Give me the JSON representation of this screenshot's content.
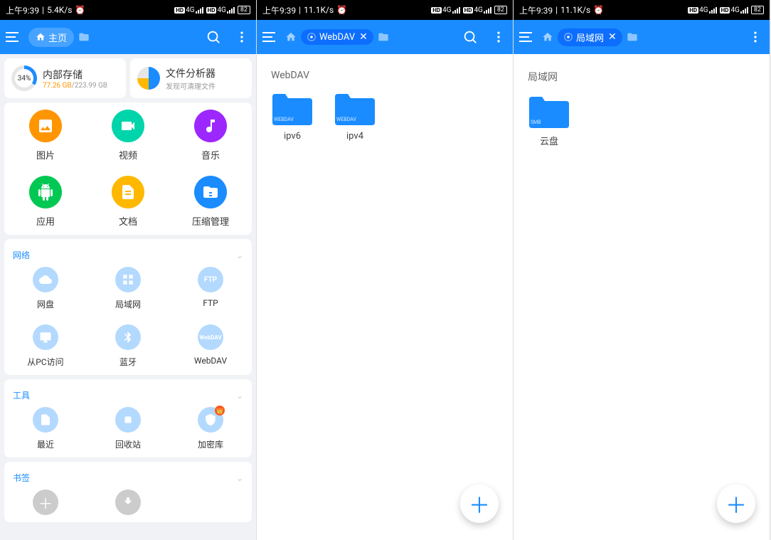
{
  "status": {
    "time": "上午9:39",
    "speed1": "5.4K/s",
    "speed2": "11.1K/s",
    "speed3": "11.1K/s",
    "net_label": "4G",
    "battery": "82"
  },
  "panel1": {
    "breadcrumb_label": "主页",
    "storage": {
      "title": "内部存储",
      "used": "77.26 GB",
      "total": "/223.99 GB",
      "percent": "34%"
    },
    "analyzer": {
      "title": "文件分析器",
      "sub": "发现可清理文件"
    },
    "categories": [
      {
        "label": "图片",
        "color": "#ff9500"
      },
      {
        "label": "视频",
        "color": "#00d4aa"
      },
      {
        "label": "音乐",
        "color": "#9c27ff"
      },
      {
        "label": "应用",
        "color": "#00c853"
      },
      {
        "label": "文档",
        "color": "#ffb800"
      },
      {
        "label": "压缩管理",
        "color": "#1a8cff"
      }
    ],
    "network": {
      "title": "网络",
      "items": [
        {
          "label": "网盘"
        },
        {
          "label": "局域网"
        },
        {
          "label": "FTP"
        },
        {
          "label": "从PC访问"
        },
        {
          "label": "蓝牙"
        },
        {
          "label": "WebDAV"
        }
      ]
    },
    "tools": {
      "title": "工具",
      "items": [
        {
          "label": "最近"
        },
        {
          "label": "回收站"
        },
        {
          "label": "加密库",
          "badge": true
        }
      ]
    },
    "bookmarks": {
      "title": "书签"
    }
  },
  "panel2": {
    "breadcrumb_label": "WebDAV",
    "heading": "WebDAV",
    "folders": [
      {
        "label": "ipv6",
        "tag": "WEBDAV"
      },
      {
        "label": "ipv4",
        "tag": "WEBDAV"
      }
    ]
  },
  "panel3": {
    "breadcrumb_label": "局域网",
    "heading": "局域网",
    "folders": [
      {
        "label": "云盘",
        "tag": "SMB"
      }
    ]
  }
}
